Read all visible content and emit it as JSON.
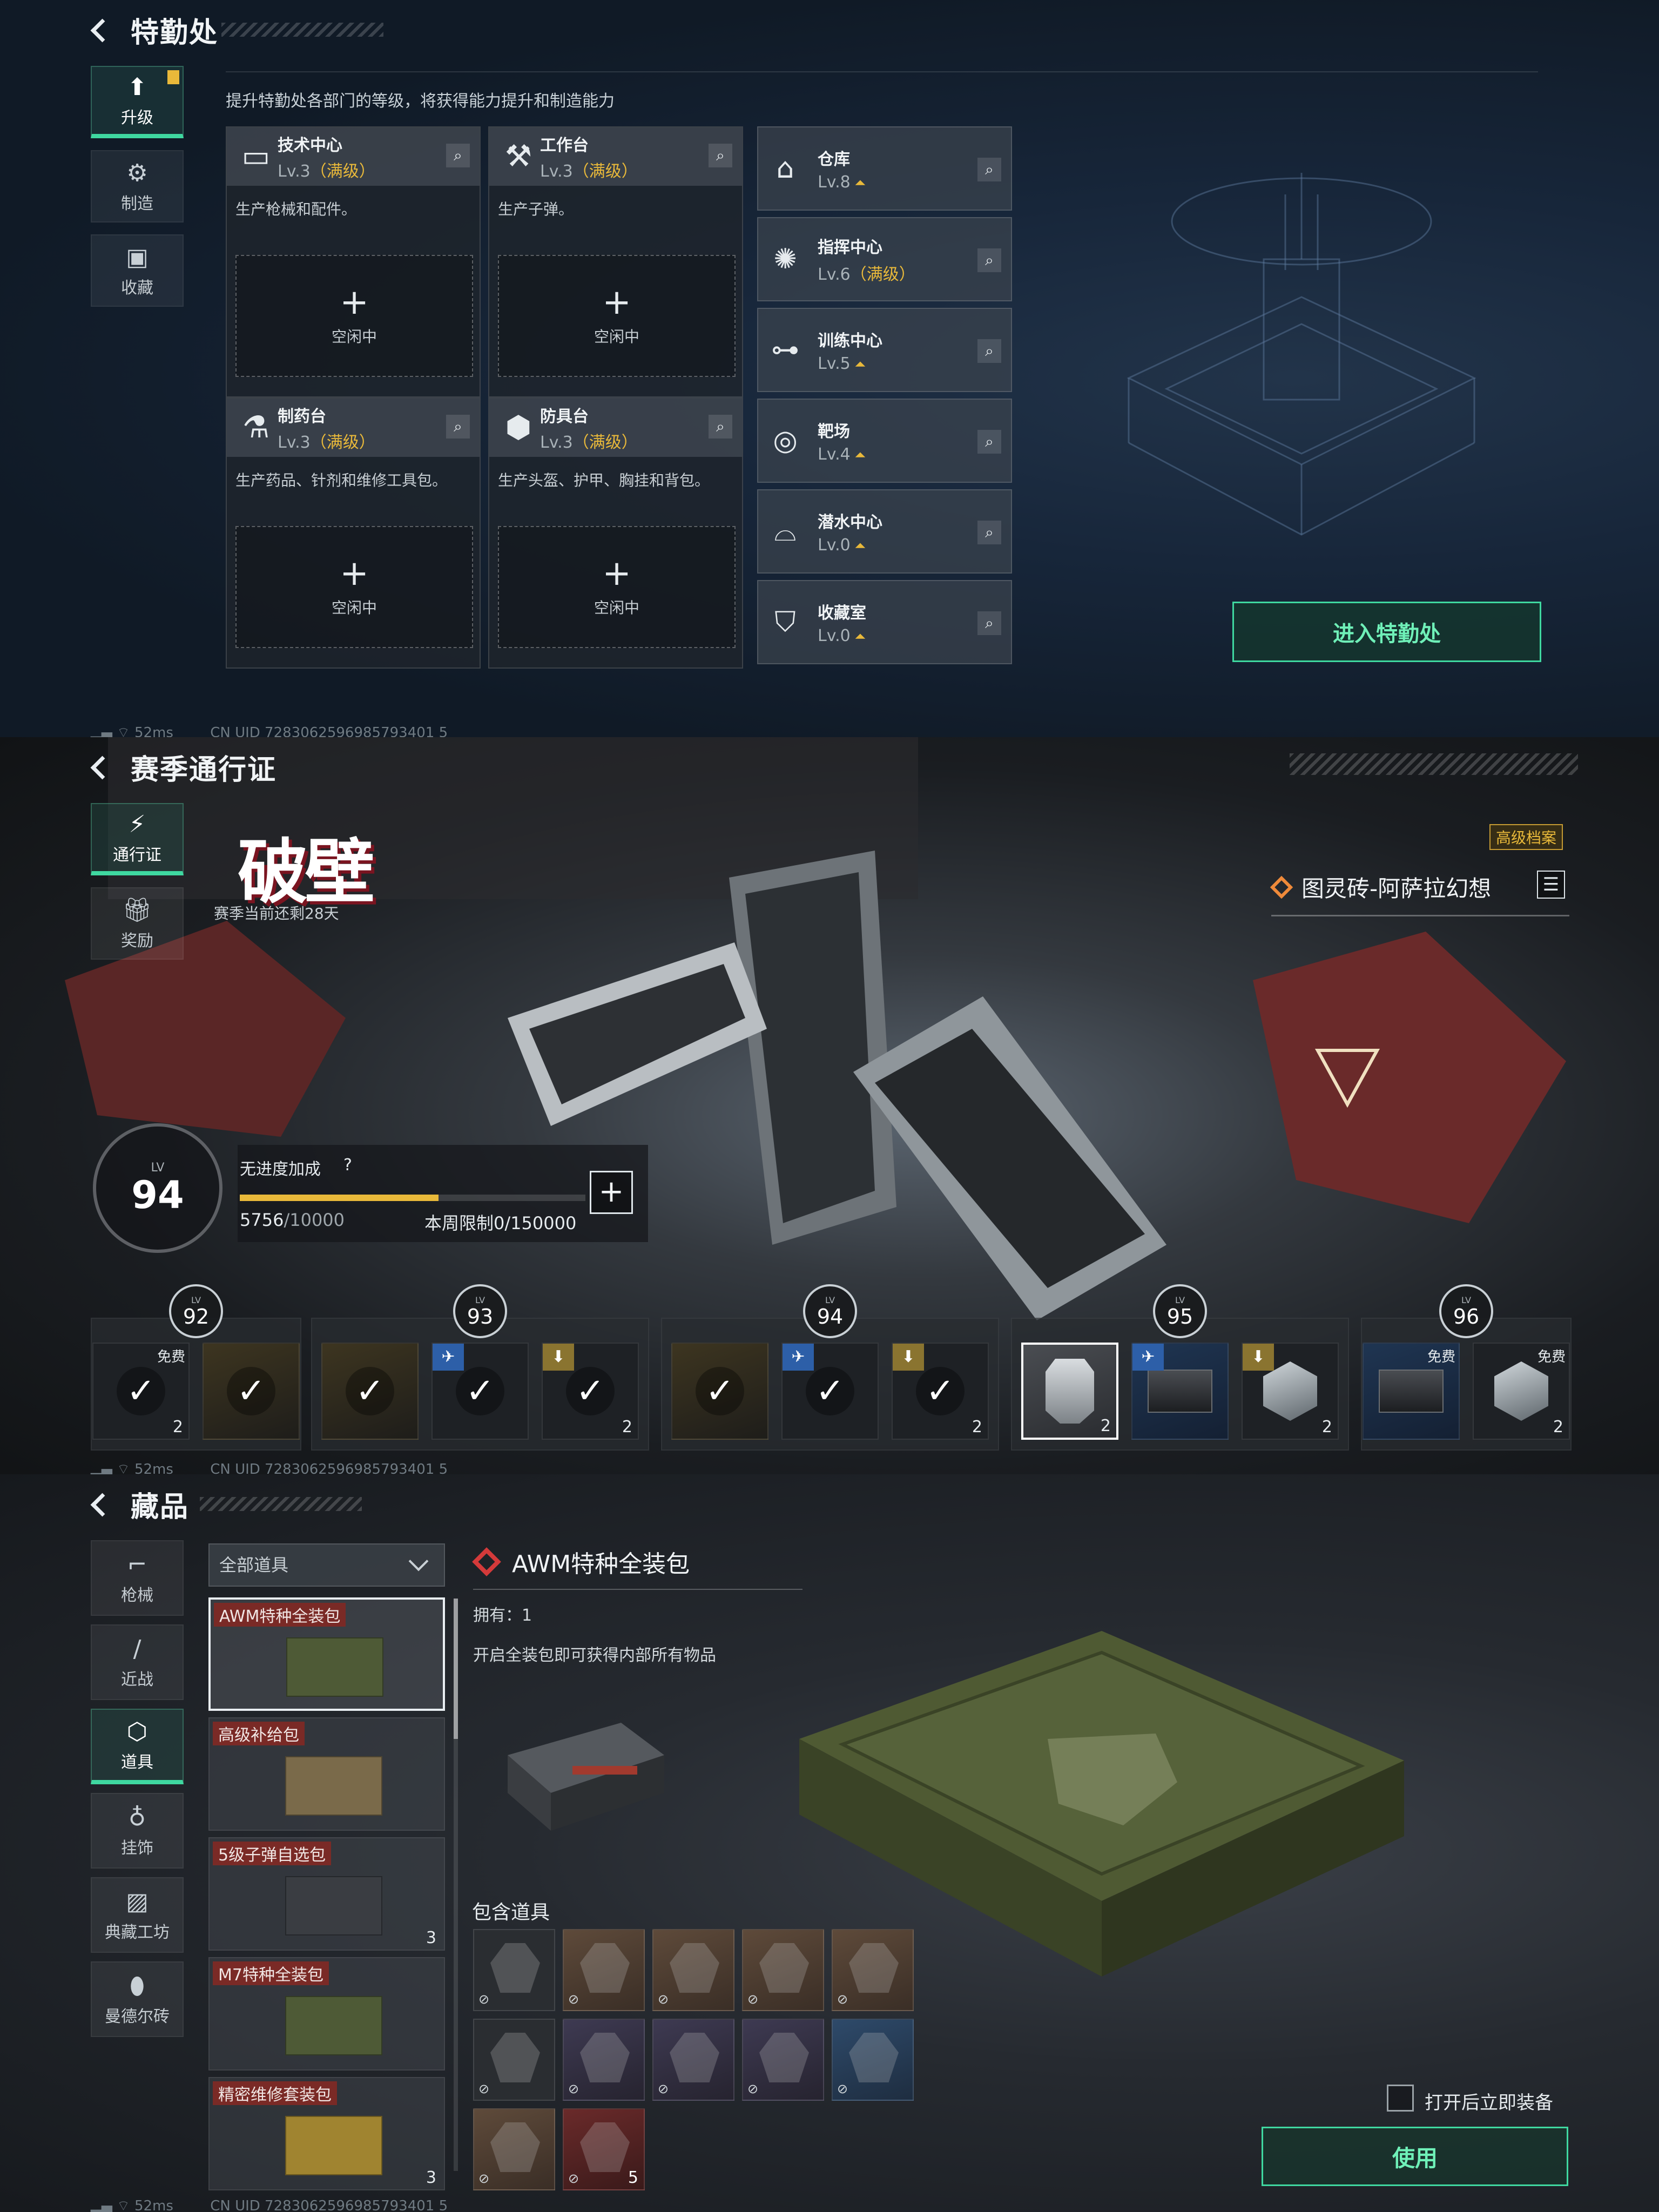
{
  "status_bar": {
    "ping": "52ms",
    "uid": "CN UID 7283062596985793401 5"
  },
  "panel1": {
    "title": "特勤处",
    "nav": [
      {
        "label": "升级",
        "icon": "upgrade-icon"
      },
      {
        "label": "制造",
        "icon": "gears-icon"
      },
      {
        "label": "收藏",
        "icon": "collection-icon"
      }
    ],
    "subtitle": "提升特勤处各部门的等级，将获得能力提升和制造能力",
    "facilities": [
      {
        "name": "技术中心",
        "level": "Lv.3",
        "max": "（满级）",
        "desc": "生产枪械和配件。",
        "slot": "空闲中",
        "icon": "tech-center-icon"
      },
      {
        "name": "工作台",
        "level": "Lv.3",
        "max": "（满级）",
        "desc": "生产子弹。",
        "slot": "空闲中",
        "icon": "workbench-icon"
      },
      {
        "name": "制药台",
        "level": "Lv.3",
        "max": "（满级）",
        "desc": "生产药品、针剂和维修工具包。",
        "slot": "空闲中",
        "icon": "pharmacy-icon"
      },
      {
        "name": "防具台",
        "level": "Lv.3",
        "max": "（满级）",
        "desc": "生产头盔、护甲、胸挂和背包。",
        "slot": "空闲中",
        "icon": "armor-bench-icon"
      }
    ],
    "rooms": [
      {
        "name": "仓库",
        "level": "Lv.8",
        "max": "",
        "icon": "warehouse-icon"
      },
      {
        "name": "指挥中心",
        "level": "Lv.6",
        "max": "（满级）",
        "icon": "command-center-icon"
      },
      {
        "name": "训练中心",
        "level": "Lv.5",
        "max": "",
        "icon": "dumbbell-icon"
      },
      {
        "name": "靶场",
        "level": "Lv.4",
        "max": "",
        "icon": "target-icon"
      },
      {
        "name": "潜水中心",
        "level": "Lv.0",
        "max": "",
        "icon": "diving-mask-icon"
      },
      {
        "name": "收藏室",
        "level": "Lv.0",
        "max": "",
        "icon": "collection-room-icon"
      }
    ],
    "enter_button": "进入特勤处"
  },
  "panel2": {
    "title": "赛季通行证",
    "nav": [
      {
        "label": "通行证",
        "icon": "pass-icon"
      },
      {
        "label": "奖励",
        "icon": "gift-icon"
      }
    ],
    "season_logo": "破壁",
    "season_days": "赛季当前还剩28天",
    "advanced_tag": "高级档案",
    "featured_item": "图灵砖-阿萨拉幻想",
    "level_caption": "LV",
    "level": "94",
    "bonus_label": "无进度加成",
    "progress_value": "5756",
    "progress_total": "/10000",
    "progress_fraction": 0.5756,
    "weekly_limit": "本周限制0/150000",
    "tiers": [
      {
        "level": "92",
        "rewards": [
          {
            "type": "check",
            "free": "免费",
            "count": "2",
            "style": "dark"
          },
          {
            "type": "check",
            "free": "",
            "count": "",
            "style": "gold"
          }
        ]
      },
      {
        "level": "93",
        "rewards": [
          {
            "type": "check",
            "free": "",
            "count": "",
            "style": "gold"
          },
          {
            "type": "check",
            "tag": "b",
            "count": "",
            "style": "dark"
          },
          {
            "type": "check",
            "tag": "g",
            "count": "2",
            "style": "dark"
          }
        ]
      },
      {
        "level": "94",
        "rewards": [
          {
            "type": "check",
            "free": "",
            "count": "",
            "style": "gold"
          },
          {
            "type": "check",
            "tag": "b",
            "count": "",
            "style": "dark"
          },
          {
            "type": "check",
            "tag": "g",
            "count": "2",
            "style": "dark"
          }
        ]
      },
      {
        "level": "95",
        "rewards": [
          {
            "type": "art",
            "count": "2",
            "style": "sel"
          },
          {
            "type": "crate",
            "tag": "b",
            "count": "",
            "style": "blue"
          },
          {
            "type": "hex",
            "tag": "g",
            "count": "2",
            "style": "dark"
          }
        ]
      },
      {
        "level": "96",
        "rewards": [
          {
            "type": "crate",
            "free": "免费",
            "count": "",
            "style": "blue"
          },
          {
            "type": "hex",
            "free": "免费",
            "count": "2",
            "style": "dark"
          }
        ]
      }
    ]
  },
  "panel3": {
    "title": "藏品",
    "nav": [
      {
        "label": "枪械",
        "icon": "gun-icon"
      },
      {
        "label": "近战",
        "icon": "knife-icon"
      },
      {
        "label": "道具",
        "icon": "items-icon"
      },
      {
        "label": "挂饰",
        "icon": "charm-icon"
      },
      {
        "label": "典藏工坊",
        "icon": "workshop-icon"
      },
      {
        "label": "曼德尔砖",
        "icon": "brick-icon"
      }
    ],
    "filter": "全部道具",
    "items": [
      {
        "name": "AWM特种全装包",
        "count": "",
        "color": "#4e5a36"
      },
      {
        "name": "高级补给包",
        "count": "",
        "color": "#7a6a4a"
      },
      {
        "name": "5级子弹自选包",
        "count": "3",
        "color": "#3a3d42"
      },
      {
        "name": "M7特种全装包",
        "count": "",
        "color": "#4e5a36"
      },
      {
        "name": "精密维修套装包",
        "count": "3",
        "color": "#a08430"
      }
    ],
    "detail_title": "AWM特种全装包",
    "owned": "拥有：1",
    "detail_desc": "开启全装包即可获得内部所有物品",
    "contains_label": "包含道具",
    "contents": [
      {
        "style": "",
        "count": "",
        "icon": "sniper-rifle-icon"
      },
      {
        "style": "brown",
        "count": "",
        "icon": "backpack-icon"
      },
      {
        "style": "brown",
        "count": "",
        "icon": "chest-rig-icon"
      },
      {
        "style": "brown",
        "count": "",
        "icon": "helmet-icon"
      },
      {
        "style": "brown",
        "count": "",
        "icon": "body-armor-icon"
      },
      {
        "style": "",
        "count": "",
        "icon": "syringe-icon"
      },
      {
        "style": "purple",
        "count": "",
        "icon": "ammo-icon"
      },
      {
        "style": "purple",
        "count": "",
        "icon": "bullet-icon"
      },
      {
        "style": "purple",
        "count": "",
        "icon": "magazine-icon"
      },
      {
        "style": "blue",
        "count": "",
        "icon": "repair-kit-icon"
      },
      {
        "style": "brown",
        "count": "",
        "icon": "medkit-icon"
      },
      {
        "style": "red",
        "count": "5",
        "icon": "ammo-box-icon"
      }
    ],
    "equip_label": "打开后立即装备",
    "use_button": "使用"
  }
}
